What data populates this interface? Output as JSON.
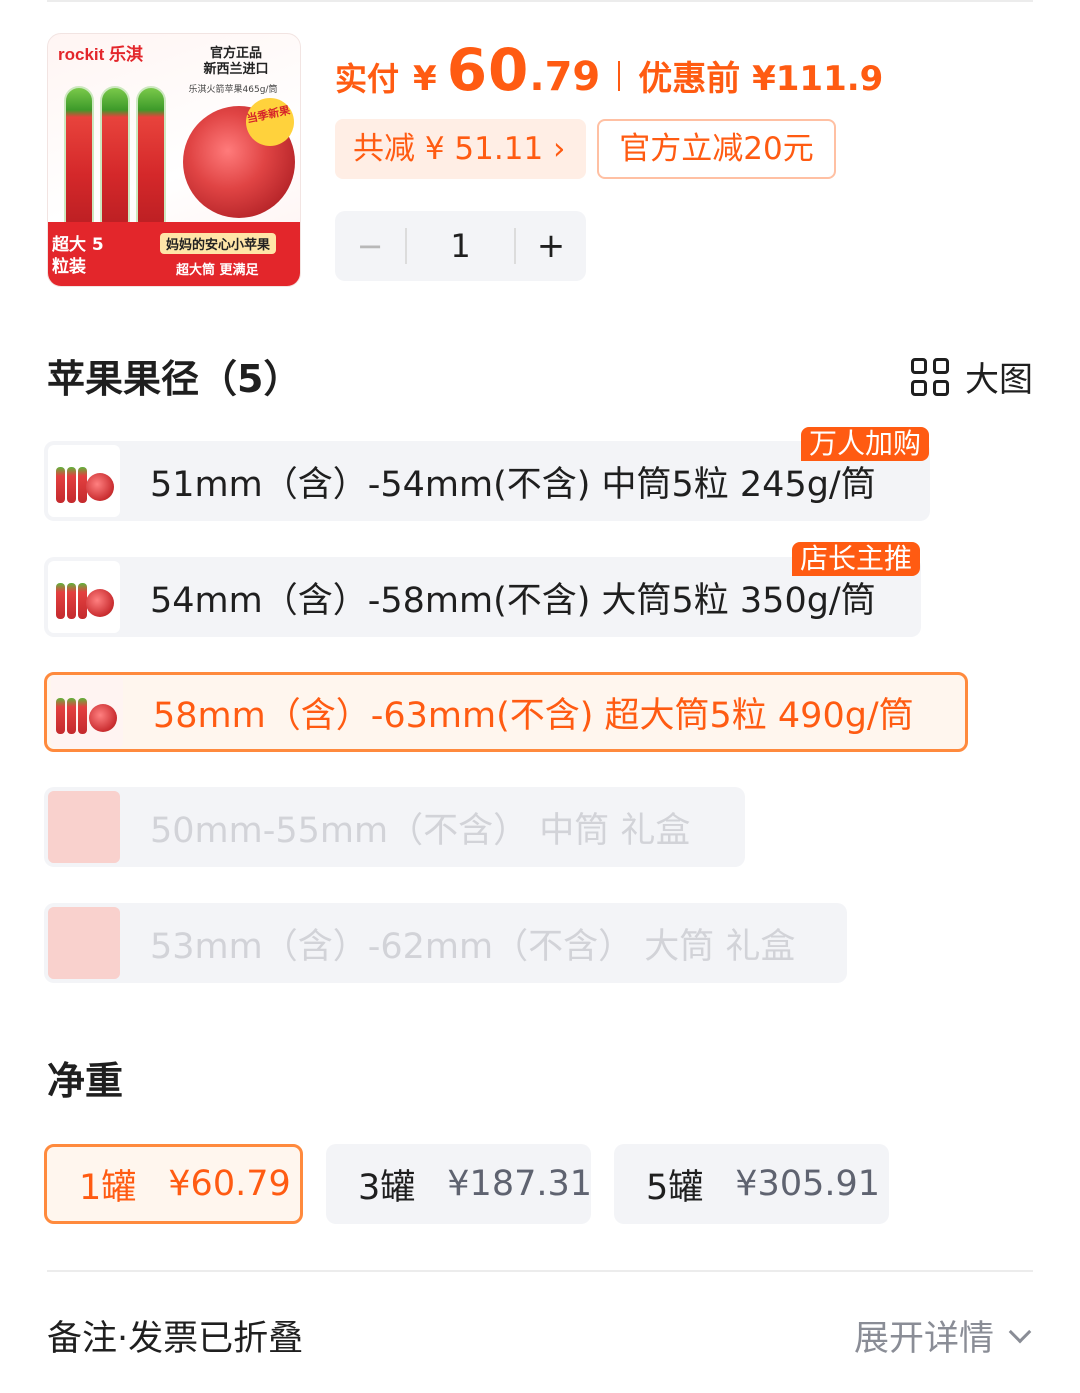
{
  "product": {
    "brand": "rockit 乐淇",
    "auth_badge": "官方正品",
    "origin_badge": "新西兰进口",
    "spec_text": "乐淇火箭苹果465g/筒",
    "new_tag": "当季新果",
    "pack_text": "超大 5粒装",
    "slogan": "妈妈的安心小苹果",
    "slogan2": "超大筒 更满足"
  },
  "price": {
    "paid_label": "实付",
    "currency": "¥",
    "paid_int": "60",
    "paid_dec": ".79",
    "orig_label": "优惠前 ¥111.9"
  },
  "discount": {
    "label": "共减 ¥ 51.11 ›"
  },
  "coupon": {
    "label": "官方立减20元"
  },
  "stepper": {
    "minus": "−",
    "qty": "1",
    "plus": "+"
  },
  "diameter": {
    "title": "苹果果径（5）",
    "bigview_label": "大图",
    "options": [
      {
        "label": "51mm（含）-54mm(不含) 中筒5粒  245g/筒",
        "tag": "万人加购",
        "state": "normal"
      },
      {
        "label": "54mm（含）-58mm(不含) 大筒5粒 350g/筒",
        "tag": "店长主推",
        "state": "normal"
      },
      {
        "label": "58mm（含）-63mm(不含) 超大筒5粒  490g/筒",
        "tag": "",
        "state": "selected"
      },
      {
        "label": "50mm-55mm（不含） 中筒  礼盒",
        "tag": "",
        "state": "disabled"
      },
      {
        "label": "53mm（含）-62mm（不含） 大筒 礼盒",
        "tag": "",
        "state": "disabled"
      }
    ]
  },
  "weight": {
    "title": "净重",
    "options": [
      {
        "qty": "1罐",
        "price": "¥60.79",
        "state": "selected"
      },
      {
        "qty": "3罐",
        "price": "¥187.31",
        "state": "normal"
      },
      {
        "qty": "5罐",
        "price": "¥305.91",
        "state": "normal"
      }
    ]
  },
  "footer": {
    "left": "备注·发票已折叠",
    "right": "展开详情"
  },
  "colors": {
    "accent": "#ff5b12",
    "selected_border": "#ff8a3d",
    "option_bg": "#f3f4f7"
  }
}
